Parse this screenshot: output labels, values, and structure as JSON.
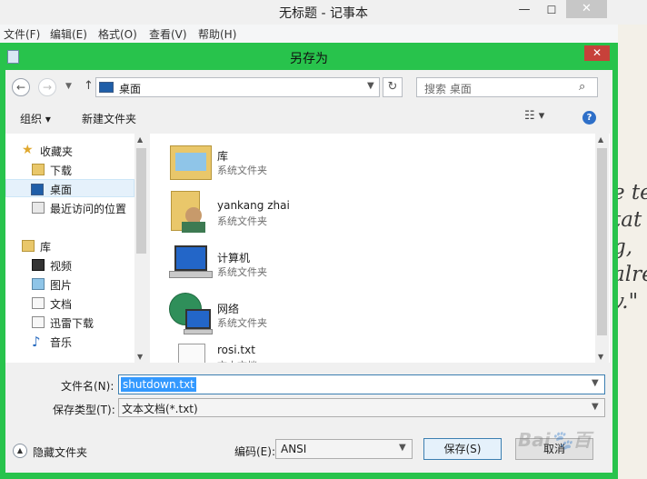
{
  "notepad": {
    "title": "无标题 - 记事本",
    "menu": [
      "文件(F)",
      "编辑(E)",
      "格式(O)",
      "查看(V)",
      "帮助(H)"
    ],
    "background_text": "e te\ntat\ng,\nalre\nv.\""
  },
  "dialog": {
    "title": "另存为",
    "address": "桌面",
    "search_placeholder": "搜索 桌面",
    "toolbar": {
      "organize": "组织 ▾",
      "new_folder": "新建文件夹"
    },
    "nav": {
      "favorites_label": "收藏夹",
      "favorites": [
        "下载",
        "桌面",
        "最近访问的位置"
      ],
      "libraries_label": "库",
      "libraries": [
        "视频",
        "图片",
        "文档",
        "迅雷下载",
        "音乐"
      ]
    },
    "files": [
      {
        "name": "库",
        "type": "系统文件夹",
        "icon": "library-icon"
      },
      {
        "name": "yankang zhai",
        "type": "系统文件夹",
        "icon": "user-folder-icon"
      },
      {
        "name": "计算机",
        "type": "系统文件夹",
        "icon": "computer-icon"
      },
      {
        "name": "网络",
        "type": "系统文件夹",
        "icon": "network-icon"
      },
      {
        "name": "rosi.txt",
        "type": "文本文档",
        "icon": "text-file-icon"
      }
    ],
    "filename_label": "文件名(N):",
    "filename_value": "shutdown.txt",
    "filetype_label": "保存类型(T):",
    "filetype_value": "文本文档(*.txt)",
    "hide_folders": "隐藏文件夹",
    "encoding_label": "编码(E):",
    "encoding_value": "ANSI",
    "save": "保存(S)",
    "cancel": "取消"
  },
  "colors": {
    "dialog_frame": "#28c34c",
    "close_red": "#c7413a",
    "selection": "#3399ff"
  }
}
